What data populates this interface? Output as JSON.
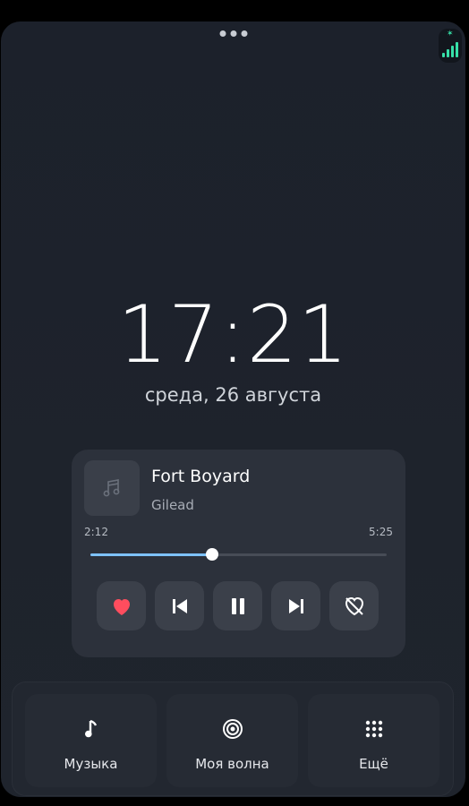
{
  "status": {
    "signal_icon": "signal-strength-icon",
    "accent_color": "#37e0a8"
  },
  "lock": {
    "time": "17:21",
    "date": "среда, 26 августа"
  },
  "player": {
    "cover_icon": "music-note-icon",
    "title": "Fort Boyard",
    "artist": "Gilead",
    "elapsed": "2:12",
    "duration": "5:25",
    "progress_fraction": 0.41,
    "accent_color": "#7ec2ff",
    "controls": [
      {
        "name": "like",
        "icon": "heart-icon"
      },
      {
        "name": "previous",
        "icon": "skip-previous-icon"
      },
      {
        "name": "pause",
        "icon": "pause-icon"
      },
      {
        "name": "next",
        "icon": "skip-next-icon"
      },
      {
        "name": "dislike",
        "icon": "heart-broken-icon"
      }
    ]
  },
  "dock": {
    "tiles": [
      {
        "label": "Музыка",
        "icon": "music-note-icon"
      },
      {
        "label": "Моя волна",
        "icon": "wave-icon"
      },
      {
        "label": "Ещё",
        "icon": "apps-grid-icon"
      }
    ]
  }
}
